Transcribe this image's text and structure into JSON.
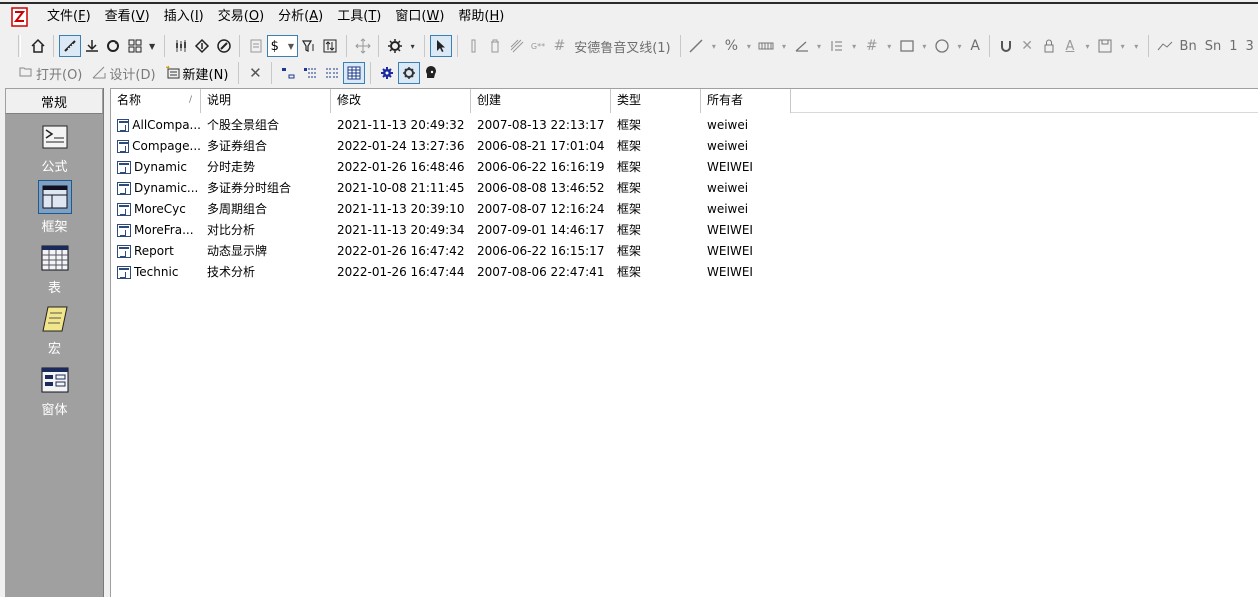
{
  "menu": {
    "items": [
      {
        "text": "文件",
        "key": "F"
      },
      {
        "text": "查看",
        "key": "V"
      },
      {
        "text": "插入",
        "key": "I"
      },
      {
        "text": "交易",
        "key": "O"
      },
      {
        "text": "分析",
        "key": "A"
      },
      {
        "text": "工具",
        "key": "T"
      },
      {
        "text": "窗口",
        "key": "W"
      },
      {
        "text": "帮助",
        "key": "H"
      }
    ]
  },
  "toolbar1": {
    "dollar": "$",
    "fork_line_label": "安德鲁音叉线(1)",
    "percent": "%",
    "text_a": "A",
    "right_labels": [
      "Bn",
      "Sn",
      "1",
      "3"
    ]
  },
  "toolbar2": {
    "open_label": "打开(O)",
    "design_label": "设计(D)",
    "new_label": "新建(N)"
  },
  "left_panel": {
    "header": "常规",
    "categories": [
      "公式",
      "框架",
      "表",
      "宏",
      "窗体"
    ]
  },
  "list": {
    "columns": [
      "名称",
      "说明",
      "修改",
      "创建",
      "类型",
      "所有者"
    ],
    "sort_indicator": "/",
    "rows": [
      {
        "name": "AllCompa...",
        "desc": "个股全景组合",
        "modified": "2021-11-13 20:49:32",
        "created": "2007-08-13 22:13:17",
        "type": "框架",
        "owner": "weiwei"
      },
      {
        "name": "Compage...",
        "desc": "多证券组合",
        "modified": "2022-01-24 13:27:36",
        "created": "2006-08-21 17:01:04",
        "type": "框架",
        "owner": "weiwei"
      },
      {
        "name": "Dynamic",
        "desc": "分时走势",
        "modified": "2022-01-26 16:48:46",
        "created": "2006-06-22 16:16:19",
        "type": "框架",
        "owner": "WEIWEI"
      },
      {
        "name": "Dynamic...",
        "desc": "多证券分时组合",
        "modified": "2021-10-08 21:11:45",
        "created": "2006-08-08 13:46:52",
        "type": "框架",
        "owner": "weiwei"
      },
      {
        "name": "MoreCyc",
        "desc": "多周期组合",
        "modified": "2021-11-13 20:39:10",
        "created": "2007-08-07 12:16:24",
        "type": "框架",
        "owner": "weiwei"
      },
      {
        "name": "MoreFra...",
        "desc": "对比分析",
        "modified": "2021-11-13 20:49:34",
        "created": "2007-09-01 14:46:17",
        "type": "框架",
        "owner": "WEIWEI"
      },
      {
        "name": "Report",
        "desc": "动态显示牌",
        "modified": "2022-01-26 16:47:42",
        "created": "2006-06-22 16:15:17",
        "type": "框架",
        "owner": "WEIWEI"
      },
      {
        "name": "Technic",
        "desc": "技术分析",
        "modified": "2022-01-26 16:47:44",
        "created": "2007-08-06 22:47:41",
        "type": "框架",
        "owner": "WEIWEI"
      }
    ]
  }
}
